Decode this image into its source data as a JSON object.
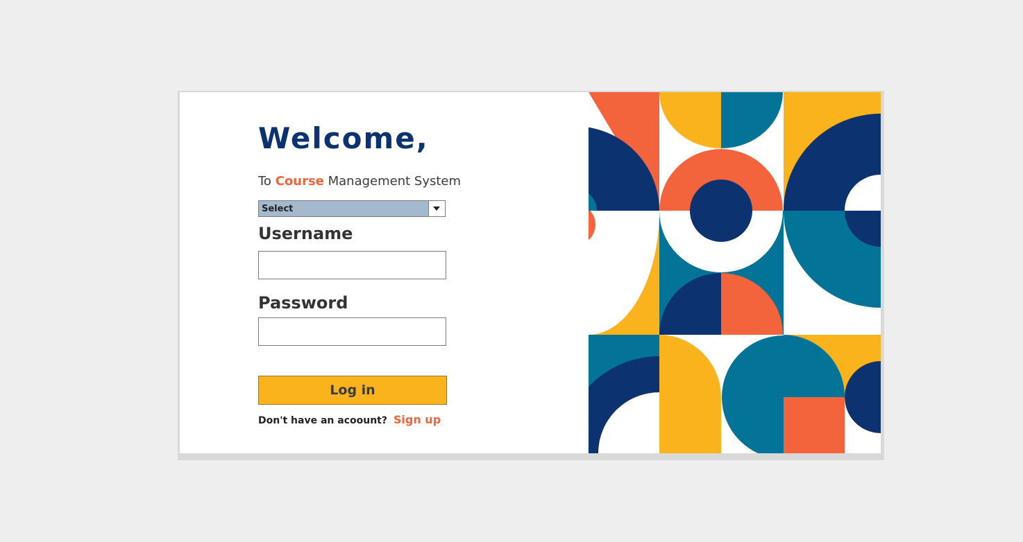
{
  "login": {
    "welcome": "Welcome,",
    "subtitle_prefix": "To",
    "subtitle_accent": "Course",
    "subtitle_suffix": "Management System",
    "role_select_value": "Select",
    "username_label": "Username",
    "username_value": "",
    "password_label": "Password",
    "password_value": "",
    "login_button": "Log in",
    "signup_prompt": "Don't have an acoount?",
    "signup_link": "Sign up"
  },
  "colors": {
    "navy": "#0d3270",
    "teal": "#037497",
    "yellow": "#fbb31d",
    "orange": "#f4643c",
    "select_bg": "#a4b8ce"
  },
  "icons": {
    "select_arrow": "chevron-down-icon"
  }
}
